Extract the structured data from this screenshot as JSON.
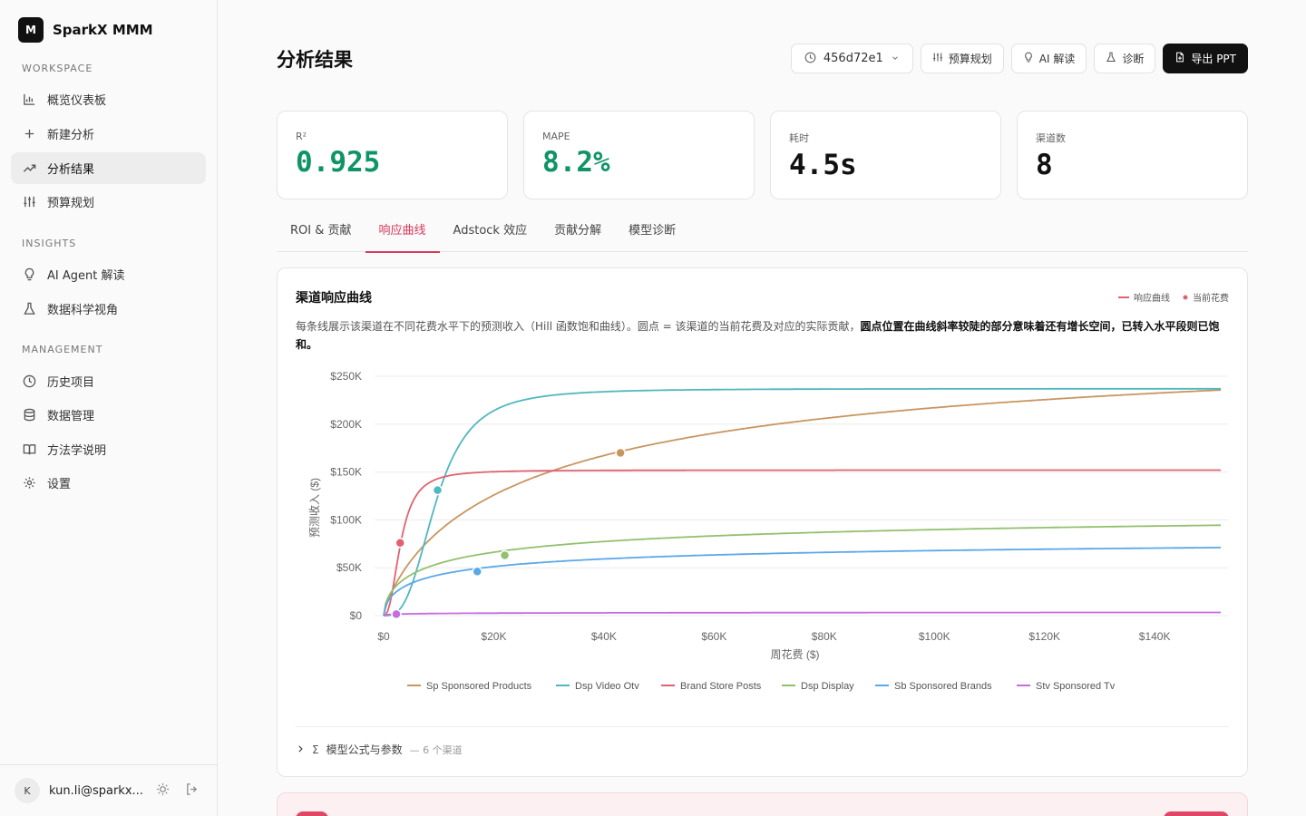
{
  "brand": {
    "logo_letter": "M",
    "name": "SparkX MMM"
  },
  "sidebar": {
    "sections": [
      "WORKSPACE",
      "INSIGHTS",
      "MANAGEMENT"
    ],
    "workspace": [
      {
        "label": "概览仪表板",
        "icon": "bar-chart-icon"
      },
      {
        "label": "新建分析",
        "icon": "plus-icon"
      },
      {
        "label": "分析结果",
        "icon": "trend-up-icon",
        "active": true
      },
      {
        "label": "预算规划",
        "icon": "sliders-icon"
      }
    ],
    "insights": [
      {
        "label": "AI Agent 解读",
        "icon": "lightbulb-icon"
      },
      {
        "label": "数据科学视角",
        "icon": "flask-icon"
      }
    ],
    "management": [
      {
        "label": "历史项目",
        "icon": "clock-icon"
      },
      {
        "label": "数据管理",
        "icon": "database-icon"
      },
      {
        "label": "方法学说明",
        "icon": "book-icon"
      },
      {
        "label": "设置",
        "icon": "gear-icon"
      }
    ],
    "user": {
      "avatar_letter": "K",
      "email": "kun.li@sparkx..."
    }
  },
  "header": {
    "title": "分析结果",
    "run_id": "456d72e1",
    "buttons": {
      "budget": "预算规划",
      "ai": "AI 解读",
      "diagnose": "诊断",
      "export": "导出 PPT"
    }
  },
  "kpis": [
    {
      "label": "R²",
      "value": "0.925"
    },
    {
      "label": "MAPE",
      "value": "8.2%"
    },
    {
      "label": "耗时",
      "value": "4.5s"
    },
    {
      "label": "渠道数",
      "value": "8"
    }
  ],
  "tabs": [
    "ROI & 贡献",
    "响应曲线",
    "Adstock 效应",
    "贡献分解",
    "模型诊断"
  ],
  "card": {
    "title": "渠道响应曲线",
    "legend_curve": "响应曲线",
    "legend_point": "当前花费",
    "desc_plain": "每条线展示该渠道在不同花费水平下的预测收入（Hill 函数饱和曲线）。圆点 = 该渠道的当前花费及对应的实际贡献，",
    "desc_bold": "圆点位置在曲线斜率较陡的部分意味着还有增长空间，已转入水平段则已饱和。",
    "formula_label": "模型公式与参数",
    "formula_meta": "— 6 个渠道"
  },
  "chart_data": {
    "type": "line",
    "xlabel": "周花费 ($)",
    "ylabel": "预测收入 ($)",
    "xlim": [
      0,
      152000
    ],
    "ylim": [
      0,
      250000
    ],
    "x_ticks": [
      0,
      20000,
      40000,
      60000,
      80000,
      100000,
      120000,
      140000
    ],
    "x_tick_labels": [
      "$0",
      "$20K",
      "$40K",
      "$60K",
      "$80K",
      "$100K",
      "$120K",
      "$140K"
    ],
    "y_ticks": [
      0,
      50000,
      100000,
      150000,
      200000,
      250000
    ],
    "y_tick_labels": [
      "$0",
      "$50K",
      "$100K",
      "$150K",
      "$200K",
      "$250K"
    ],
    "grid": true,
    "legend_position": "bottom",
    "series": [
      {
        "name": "Sp Sponsored Products",
        "color": "#c9955f",
        "vmax": 300000,
        "k": 30000,
        "n": 0.8,
        "current": [
          43000,
          170000
        ]
      },
      {
        "name": "Dsp Video Otv",
        "color": "#4fb8bf",
        "vmax": 237000,
        "k": 9500,
        "n": 3.0,
        "current": [
          9800,
          131000
        ]
      },
      {
        "name": "Brand Store Posts",
        "color": "#e06270",
        "vmax": 152000,
        "k": 3100,
        "n": 2.4,
        "current": [
          3000,
          76000
        ]
      },
      {
        "name": "Dsp Display",
        "color": "#93c06e",
        "vmax": 115000,
        "k": 12000,
        "n": 0.6,
        "current": [
          22000,
          63000
        ]
      },
      {
        "name": "Sb Sponsored Brands",
        "color": "#5aa8e8",
        "vmax": 85000,
        "k": 10000,
        "n": 0.6,
        "current": [
          17000,
          46000
        ]
      },
      {
        "name": "Stv Sponsored Tv",
        "color": "#c66be0",
        "vmax": 4000,
        "k": 6000,
        "n": 0.5,
        "current": [
          2300,
          1500
        ]
      }
    ]
  }
}
